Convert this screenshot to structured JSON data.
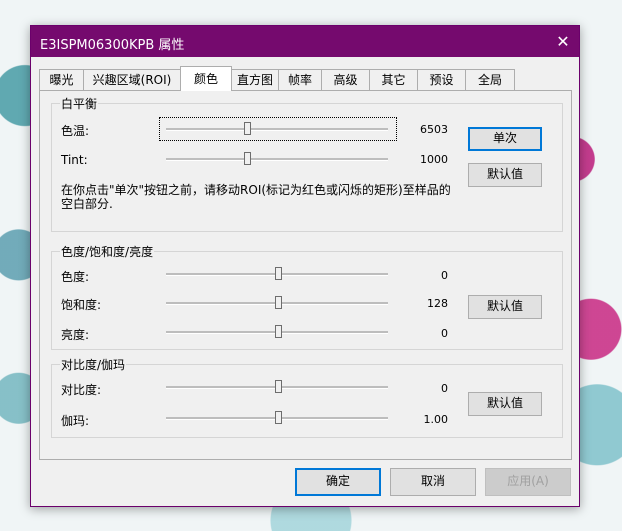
{
  "window": {
    "title": "E3ISPM06300KPB 属性",
    "close_glyph": "✕"
  },
  "tabs": [
    {
      "label": "曝光",
      "active": false
    },
    {
      "label": "兴趣区域(ROI)",
      "active": false
    },
    {
      "label": "颜色",
      "active": true
    },
    {
      "label": "直方图",
      "active": false
    },
    {
      "label": "帧率",
      "active": false
    },
    {
      "label": "高级",
      "active": false
    },
    {
      "label": "其它",
      "active": false
    },
    {
      "label": "预设",
      "active": false
    },
    {
      "label": "全局",
      "active": false
    }
  ],
  "white_balance": {
    "title": "白平衡",
    "temp_label": "色温:",
    "temp_value": "6503",
    "temp_fraction": 0.36,
    "tint_label": "Tint:",
    "tint_value": "1000",
    "tint_fraction": 0.36,
    "once_button": "单次",
    "default_button": "默认值",
    "note": "在你点击\"单次\"按钮之前，请移动ROI(标记为红色或闪烁的矩形)至样品的空白部分."
  },
  "hsb": {
    "title": "色度/饱和度/亮度",
    "hue_label": "色度:",
    "hue_value": "0",
    "hue_fraction": 0.5,
    "sat_label": "饱和度:",
    "sat_value": "128",
    "sat_fraction": 0.5,
    "bright_label": "亮度:",
    "bright_value": "0",
    "bright_fraction": 0.5,
    "default_button": "默认值"
  },
  "contrast_gamma": {
    "title": "对比度/伽玛",
    "contrast_label": "对比度:",
    "contrast_value": "0",
    "contrast_fraction": 0.5,
    "gamma_label": "伽玛:",
    "gamma_value": "1.00",
    "gamma_fraction": 0.5,
    "default_button": "默认值"
  },
  "footer": {
    "ok_button": "确定",
    "cancel_button": "取消",
    "apply_button": "应用(A)"
  },
  "colors": {
    "titlebar": "#750a6e",
    "accent": "#0078d7"
  }
}
